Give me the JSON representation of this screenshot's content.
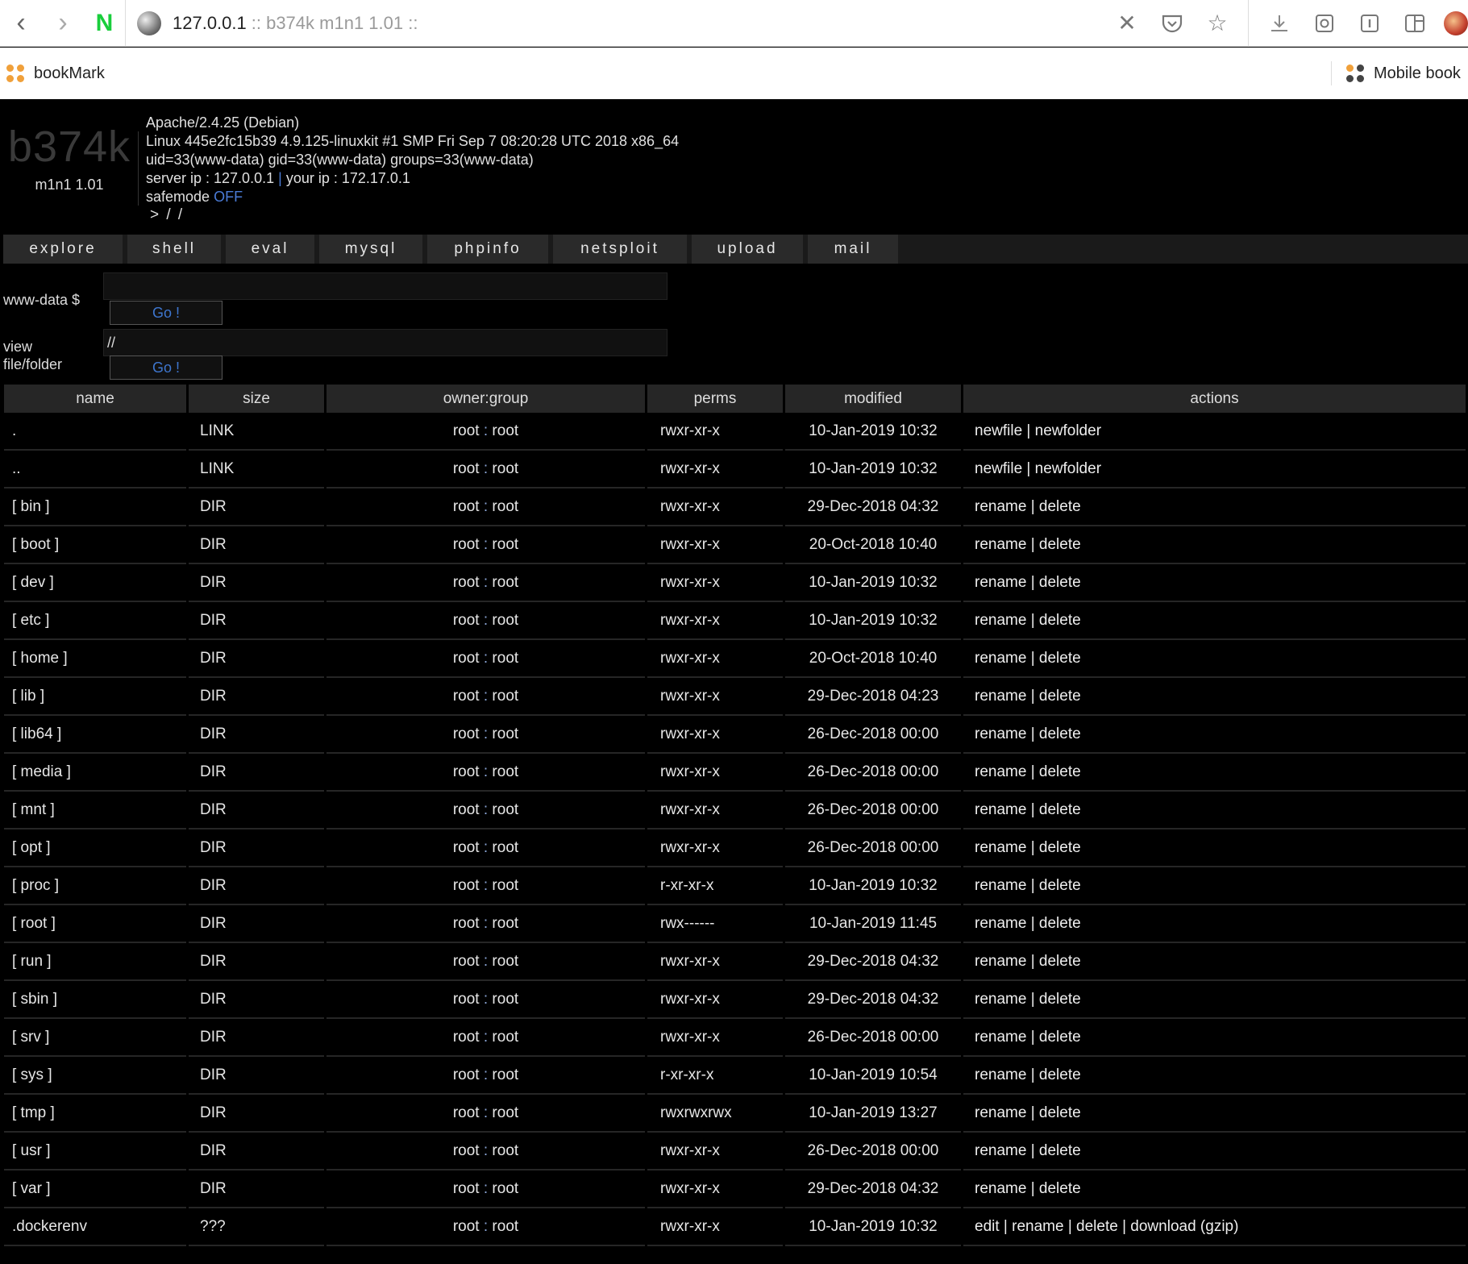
{
  "browser": {
    "url_host": "127.0.0.1",
    "url_title": ":: b374k m1n1 1.01 ::",
    "bookmark_left": "bookMark",
    "bookmark_right": "Mobile book"
  },
  "brand": {
    "logo": "b374k",
    "version": "m1n1 1.01"
  },
  "sysinfo": {
    "server": "Apache/2.4.25 (Debian)",
    "uname": "Linux 445e2fc15b39 4.9.125-linuxkit #1 SMP Fri Sep 7 08:20:28 UTC 2018 x86_64",
    "uid": "uid=33(www-data) gid=33(www-data) groups=33(www-data)",
    "server_ip_label": "server ip : 127.0.0.1",
    "ip_sep": "|",
    "your_ip_label": "your ip : 172.17.0.1",
    "safemode_label": "safemode",
    "safemode_value": "OFF",
    "path": "> / /"
  },
  "menu": [
    "explore",
    "shell",
    "eval",
    "mysql",
    "phpinfo",
    "netsploit",
    "upload",
    "mail"
  ],
  "shell_form": {
    "prompt": "www-data $",
    "value": "",
    "go": "Go !"
  },
  "view_form": {
    "label_line1": "view",
    "label_line2": "file/folder",
    "value": "//",
    "go": "Go !"
  },
  "table": {
    "headers": [
      "name",
      "size",
      "owner:group",
      "perms",
      "modified",
      "actions"
    ],
    "rows": [
      {
        "name": ".",
        "size": "LINK",
        "owner": "root",
        "group": "root",
        "perms": "rwxr-xr-x",
        "modified": "10-Jan-2019 10:32",
        "actions": "newfile | newfolder"
      },
      {
        "name": "..",
        "size": "LINK",
        "owner": "root",
        "group": "root",
        "perms": "rwxr-xr-x",
        "modified": "10-Jan-2019 10:32",
        "actions": "newfile | newfolder"
      },
      {
        "name": "[ bin ]",
        "size": "DIR",
        "owner": "root",
        "group": "root",
        "perms": "rwxr-xr-x",
        "modified": "29-Dec-2018 04:32",
        "actions": "rename | delete"
      },
      {
        "name": "[ boot ]",
        "size": "DIR",
        "owner": "root",
        "group": "root",
        "perms": "rwxr-xr-x",
        "modified": "20-Oct-2018 10:40",
        "actions": "rename | delete"
      },
      {
        "name": "[ dev ]",
        "size": "DIR",
        "owner": "root",
        "group": "root",
        "perms": "rwxr-xr-x",
        "modified": "10-Jan-2019 10:32",
        "actions": "rename | delete"
      },
      {
        "name": "[ etc ]",
        "size": "DIR",
        "owner": "root",
        "group": "root",
        "perms": "rwxr-xr-x",
        "modified": "10-Jan-2019 10:32",
        "actions": "rename | delete"
      },
      {
        "name": "[ home ]",
        "size": "DIR",
        "owner": "root",
        "group": "root",
        "perms": "rwxr-xr-x",
        "modified": "20-Oct-2018 10:40",
        "actions": "rename | delete"
      },
      {
        "name": "[ lib ]",
        "size": "DIR",
        "owner": "root",
        "group": "root",
        "perms": "rwxr-xr-x",
        "modified": "29-Dec-2018 04:23",
        "actions": "rename | delete"
      },
      {
        "name": "[ lib64 ]",
        "size": "DIR",
        "owner": "root",
        "group": "root",
        "perms": "rwxr-xr-x",
        "modified": "26-Dec-2018 00:00",
        "actions": "rename | delete"
      },
      {
        "name": "[ media ]",
        "size": "DIR",
        "owner": "root",
        "group": "root",
        "perms": "rwxr-xr-x",
        "modified": "26-Dec-2018 00:00",
        "actions": "rename | delete"
      },
      {
        "name": "[ mnt ]",
        "size": "DIR",
        "owner": "root",
        "group": "root",
        "perms": "rwxr-xr-x",
        "modified": "26-Dec-2018 00:00",
        "actions": "rename | delete"
      },
      {
        "name": "[ opt ]",
        "size": "DIR",
        "owner": "root",
        "group": "root",
        "perms": "rwxr-xr-x",
        "modified": "26-Dec-2018 00:00",
        "actions": "rename | delete"
      },
      {
        "name": "[ proc ]",
        "size": "DIR",
        "owner": "root",
        "group": "root",
        "perms": "r-xr-xr-x",
        "modified": "10-Jan-2019 10:32",
        "actions": "rename | delete"
      },
      {
        "name": "[ root ]",
        "size": "DIR",
        "owner": "root",
        "group": "root",
        "perms": "rwx------",
        "modified": "10-Jan-2019 11:45",
        "actions": "rename | delete"
      },
      {
        "name": "[ run ]",
        "size": "DIR",
        "owner": "root",
        "group": "root",
        "perms": "rwxr-xr-x",
        "modified": "29-Dec-2018 04:32",
        "actions": "rename | delete"
      },
      {
        "name": "[ sbin ]",
        "size": "DIR",
        "owner": "root",
        "group": "root",
        "perms": "rwxr-xr-x",
        "modified": "29-Dec-2018 04:32",
        "actions": "rename | delete"
      },
      {
        "name": "[ srv ]",
        "size": "DIR",
        "owner": "root",
        "group": "root",
        "perms": "rwxr-xr-x",
        "modified": "26-Dec-2018 00:00",
        "actions": "rename | delete"
      },
      {
        "name": "[ sys ]",
        "size": "DIR",
        "owner": "root",
        "group": "root",
        "perms": "r-xr-xr-x",
        "modified": "10-Jan-2019 10:54",
        "actions": "rename | delete"
      },
      {
        "name": "[ tmp ]",
        "size": "DIR",
        "owner": "root",
        "group": "root",
        "perms": "rwxrwxrwx",
        "modified": "10-Jan-2019 13:27",
        "actions": "rename | delete"
      },
      {
        "name": "[ usr ]",
        "size": "DIR",
        "owner": "root",
        "group": "root",
        "perms": "rwxr-xr-x",
        "modified": "26-Dec-2018 00:00",
        "actions": "rename | delete"
      },
      {
        "name": "[ var ]",
        "size": "DIR",
        "owner": "root",
        "group": "root",
        "perms": "rwxr-xr-x",
        "modified": "29-Dec-2018 04:32",
        "actions": "rename | delete"
      },
      {
        "name": ".dockerenv",
        "size": "???",
        "owner": "root",
        "group": "root",
        "perms": "rwxr-xr-x",
        "modified": "10-Jan-2019 10:32",
        "actions": "edit | rename | delete | download (gzip)"
      }
    ]
  },
  "icons": {
    "back": "back-arrow-icon",
    "forward": "forward-arrow-icon",
    "site": "globe-icon",
    "close": "close-icon",
    "pocket": "pocket-icon",
    "star": "star-icon",
    "download": "download-icon",
    "screenshot": "screenshot-icon",
    "reader": "reader-icon",
    "sidebar": "sidebar-icon"
  }
}
